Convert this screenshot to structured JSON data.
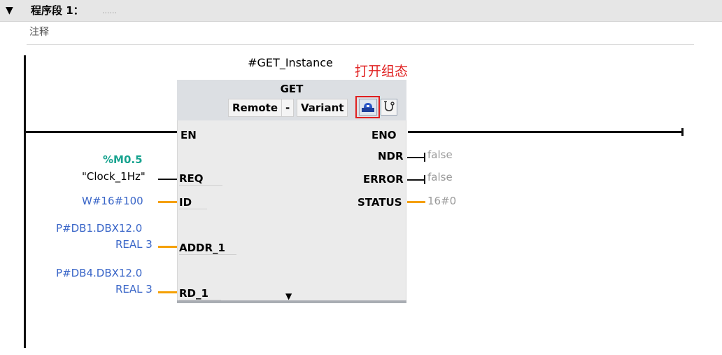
{
  "network": {
    "collapse_icon": "▼",
    "title": "程序段 1：",
    "title_placeholder": "......",
    "comment": "注释"
  },
  "block": {
    "instance": "#GET_Instance",
    "type": "GET",
    "remote_label": "Remote",
    "separator": "-",
    "variant_label": "Variant",
    "config_icon": "configuration-icon",
    "diagnostics_icon": "diagnostics-icon",
    "expand_icon": "▼",
    "inputs": {
      "en": "EN",
      "req": "REQ",
      "id": "ID",
      "addr_1": "ADDR_1",
      "rd_1": "RD_1"
    },
    "outputs": {
      "eno": "ENO",
      "ndr": "NDR",
      "error": "ERROR",
      "status": "STATUS"
    }
  },
  "operands": {
    "req_address": "%M0.5",
    "req_value": "\"Clock_1Hz\"",
    "id_value": "W#16#100",
    "addr_1_line1": "P#DB1.DBX12.0",
    "addr_1_line2": "REAL 3",
    "rd_1_line1": "P#DB4.DBX12.0",
    "rd_1_line2": "REAL 3",
    "ndr_value": "false",
    "error_value": "false",
    "status_value": "16#0"
  },
  "annotation": {
    "text": "打开组态",
    "color": "#e02020"
  },
  "colors": {
    "wire_orange": "#f5a000",
    "operand_blue": "#3a66c8",
    "address_teal": "#17a38f"
  }
}
